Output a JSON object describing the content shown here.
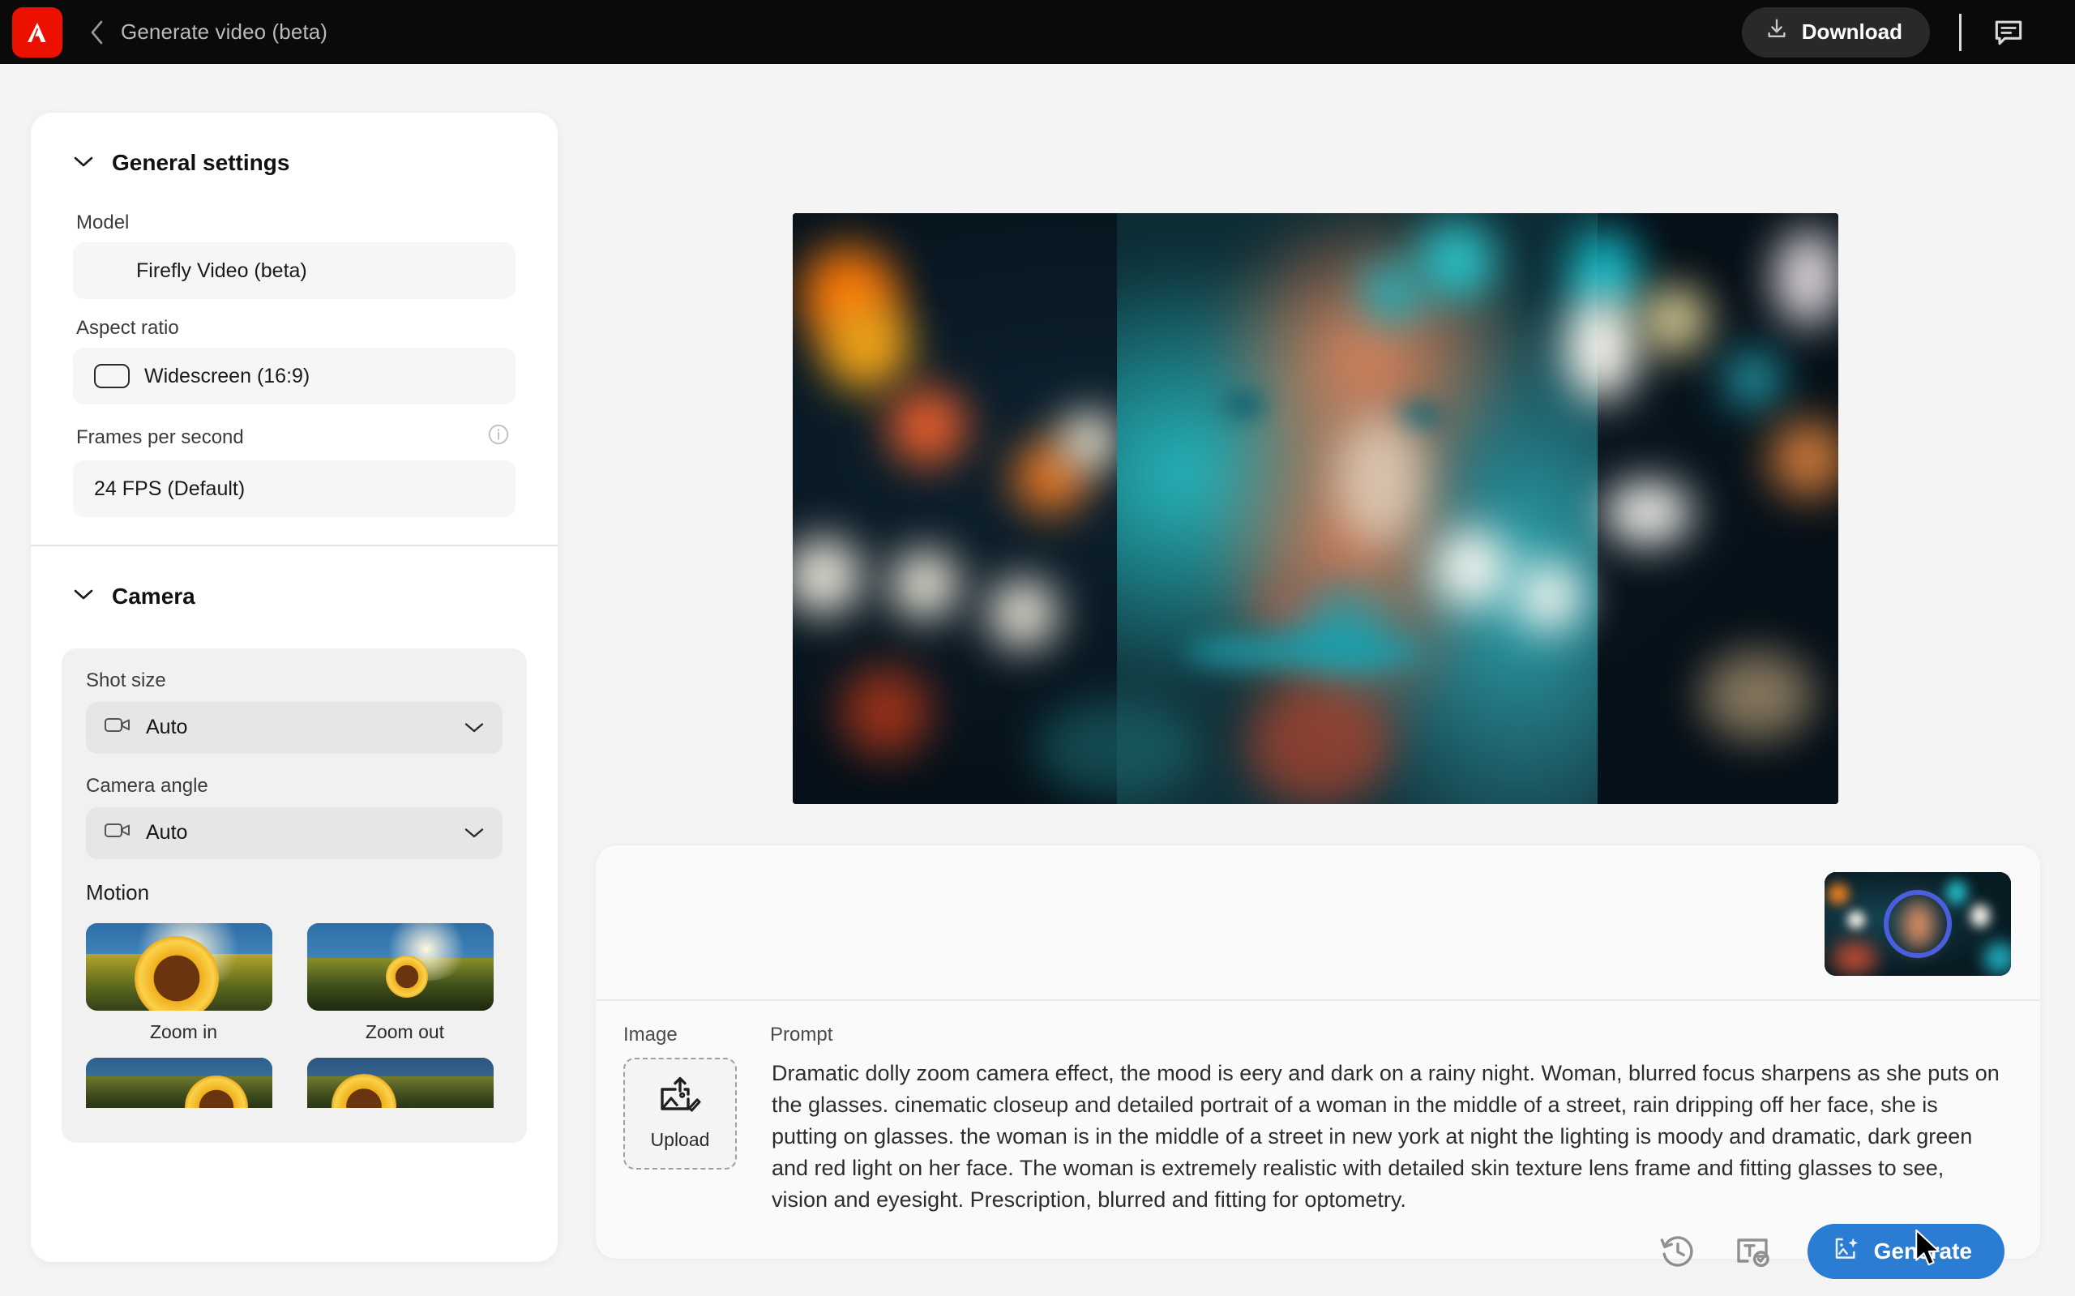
{
  "topbar": {
    "logo_icon": "adobe-logo-icon",
    "back_icon": "chevron-left-icon",
    "title": "Generate video (beta)",
    "download_label": "Download",
    "download_icon": "download-icon",
    "feedback_icon": "feedback-chat-icon",
    "bg_color": "#0a0a0a",
    "logo_color": "#eb1000"
  },
  "sidebar": {
    "general_settings": {
      "title": "General settings",
      "collapse_icon": "chevron-down-icon",
      "fields": [
        {
          "label": "Model",
          "value": "Firefly Video (beta)",
          "icon": null,
          "info": false
        },
        {
          "label": "Aspect ratio",
          "value": "Widescreen (16:9)",
          "icon": "aspect-ratio-icon",
          "info": false
        },
        {
          "label": "Frames per second",
          "value": "24 FPS (Default)",
          "icon": null,
          "info": true,
          "info_icon": "info-icon"
        }
      ]
    },
    "camera": {
      "title": "Camera",
      "collapse_icon": "chevron-down-icon",
      "selects": [
        {
          "label": "Shot size",
          "value": "Auto",
          "icon": "video-camera-icon",
          "chevron": "chevron-down-icon"
        },
        {
          "label": "Camera angle",
          "value": "Auto",
          "icon": "video-camera-icon",
          "chevron": "chevron-down-icon"
        }
      ],
      "motion": {
        "label": "Motion",
        "options": [
          {
            "caption": "Zoom in"
          },
          {
            "caption": "Zoom out"
          },
          {
            "caption": ""
          },
          {
            "caption": ""
          }
        ]
      }
    }
  },
  "main": {
    "preview": {
      "name": "video-preview",
      "alt": "Blurred cinematic night-street bokeh portrait of a woman"
    },
    "prompt_panel": {
      "thumbnail": {
        "name": "generated-video-thumbnail",
        "ring_color": "#4a5ee0"
      },
      "image_label": "Image",
      "upload_label": "Upload",
      "upload_icon": "image-upload-icon",
      "prompt_label": "Prompt",
      "prompt_text": "Dramatic dolly zoom camera effect, the mood is eery and dark on a rainy night. Woman, blurred focus sharpens as she puts on the glasses. cinematic closeup and detailed portrait of a woman in the middle of a street, rain dripping off her face, she is putting on glasses. the woman is in the middle of a street in new york at night the lighting is moody and dramatic, dark green and red light on her face. The woman is extremely realistic with detailed skin texture lens frame and fitting glasses to see, vision and eyesight. Prescription, blurred and fitting for optometry.",
      "history_icon": "history-clock-icon",
      "text_check_icon": "text-prompt-check-icon",
      "generate_label": "Generate",
      "generate_icon": "sparkle-generate-icon",
      "generate_color": "#2b7cd3"
    }
  }
}
